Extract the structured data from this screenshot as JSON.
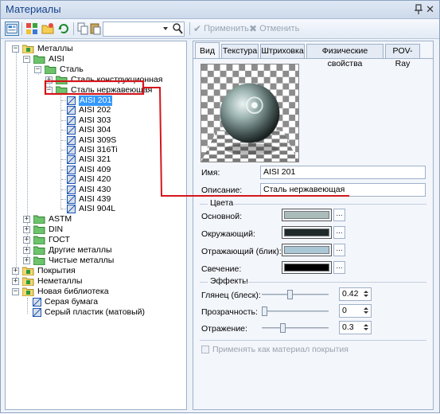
{
  "window": {
    "title": "Материалы"
  },
  "toolbar": {
    "icons": [
      "properties-icon",
      "materials-icon",
      "folder-icon",
      "refresh-icon",
      "copy-icon",
      "paste-icon"
    ],
    "search_value": "",
    "apply_label": "Применить",
    "cancel_label": "Отменить"
  },
  "tree": {
    "metals": "Металлы",
    "aisi": "AISI",
    "steel": "Сталь",
    "structural": "Сталь конструкционная",
    "stainless": "Сталь нержавеющая",
    "grades": [
      "AISI 201",
      "AISI 202",
      "AISI 303",
      "AISI 304",
      "AISI 309S",
      "AISI 316Ti",
      "AISI 321",
      "AISI 409",
      "AISI 420",
      "AISI 430",
      "AISI 439",
      "AISI 904L"
    ],
    "astm": "ASTM",
    "din": "DIN",
    "gost": "ГОСТ",
    "other_metals": "Другие металлы",
    "pure_metals": "Чистые металлы",
    "coatings": "Покрытия",
    "nonmetals": "Неметаллы",
    "new_library": "Новая библиотека",
    "paper": "Серая бумага",
    "plastic": "Серый пластик (матовый)"
  },
  "tabs": [
    "Вид",
    "Текстура",
    "Штриховка",
    "Физические свойства",
    "POV-Ray"
  ],
  "material": {
    "name_label": "Имя:",
    "name_value": "AISI 201",
    "desc_label": "Описание:",
    "desc_value": "Сталь нержавеющая"
  },
  "colors": {
    "group": "Цвета",
    "items": [
      {
        "label": "Основной:",
        "color": "#a9bcb9"
      },
      {
        "label": "Окружающий:",
        "color": "#1e2a2a"
      },
      {
        "label": "Отражающий (блик):",
        "color": "#aac7d6"
      },
      {
        "label": "Свечение:",
        "color": "#000000"
      }
    ],
    "more": "..."
  },
  "effects": {
    "group": "Эффекты",
    "items": [
      {
        "label": "Глянец (блеск):",
        "value": "0.42",
        "level": 0.42
      },
      {
        "label": "Прозрачность:",
        "value": "0",
        "level": 0
      },
      {
        "label": "Отражение:",
        "value": "0.3",
        "level": 0.3
      }
    ]
  },
  "coating_checkbox": "Применять как материал покрытия",
  "accent": "#d4161c"
}
